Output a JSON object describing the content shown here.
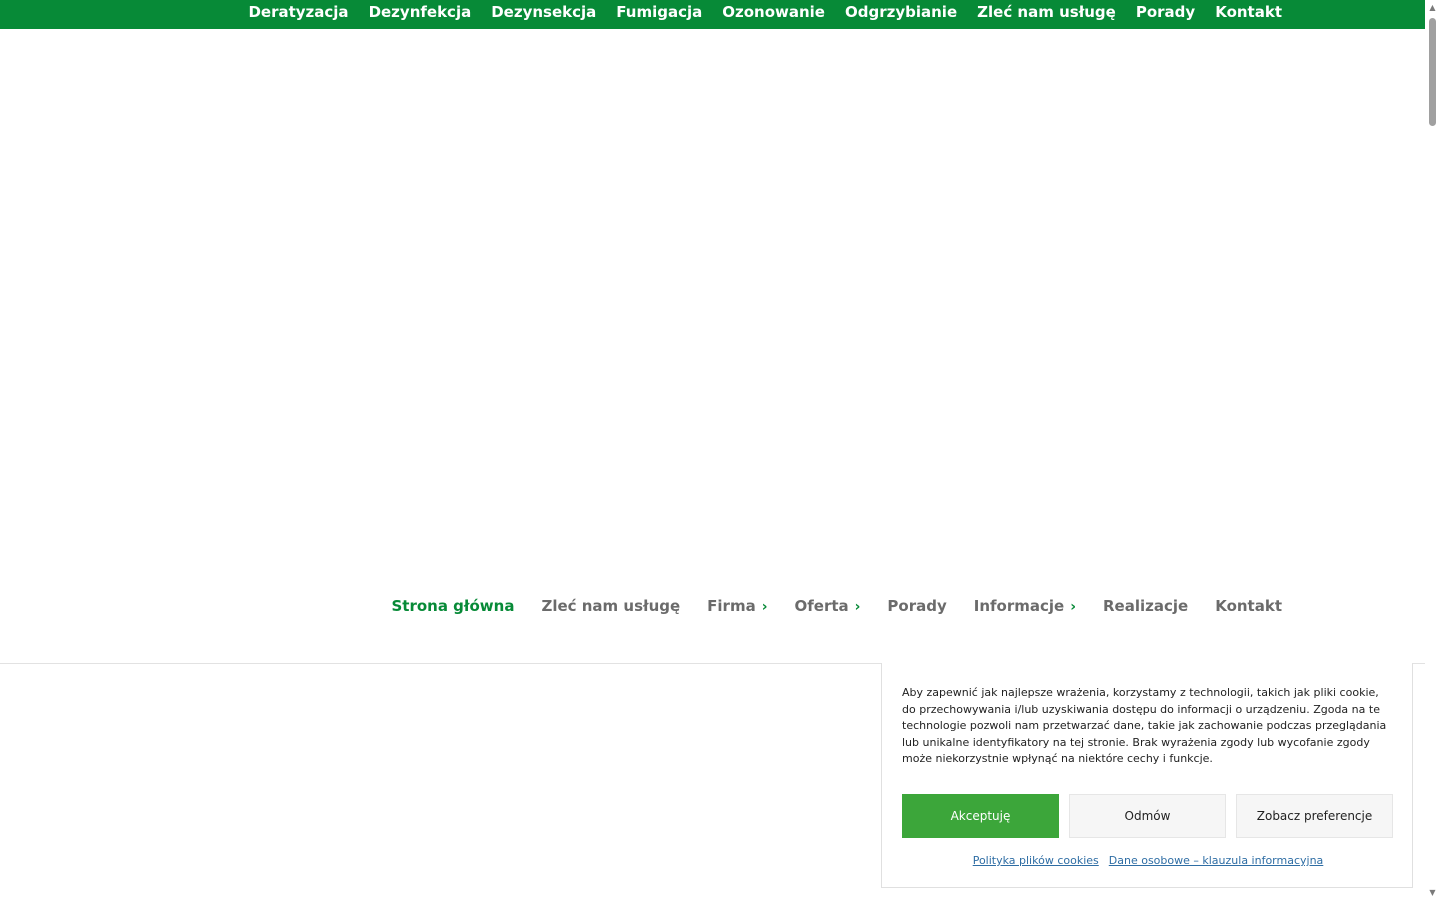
{
  "topbar": {
    "links": [
      "Deratyzacja",
      "Dezynfekcja",
      "Dezynsekcja",
      "Fumigacja",
      "Ozonowanie",
      "Odgrzybianie",
      "Zleć nam usługę",
      "Porady",
      "Kontakt"
    ]
  },
  "mainnav": {
    "items": [
      {
        "label": "Strona główna",
        "active": true,
        "has_submenu": false
      },
      {
        "label": "Zleć nam usługę",
        "active": false,
        "has_submenu": false
      },
      {
        "label": "Firma",
        "active": false,
        "has_submenu": true
      },
      {
        "label": "Oferta",
        "active": false,
        "has_submenu": true
      },
      {
        "label": "Porady",
        "active": false,
        "has_submenu": false
      },
      {
        "label": "Informacje",
        "active": false,
        "has_submenu": true
      },
      {
        "label": "Realizacje",
        "active": false,
        "has_submenu": false
      },
      {
        "label": "Kontakt",
        "active": false,
        "has_submenu": false
      }
    ],
    "submenu_icon": "chevron-right-icon"
  },
  "cookie_banner": {
    "text": "Aby zapewnić jak najlepsze wrażenia, korzystamy z technologii, takich jak pliki cookie, do przechowywania i/lub uzyskiwania dostępu do informacji o urządzeniu. Zgoda na te technologie pozwoli nam przetwarzać dane, takie jak zachowanie podczas przeglądania lub unikalne identyfikatory na tej stronie. Brak wyrażenia zgody lub wycofanie zgody może niekorzystnie wpłynąć na niektóre cechy i funkcje.",
    "accept_label": "Akceptuję",
    "deny_label": "Odmów",
    "prefs_label": "Zobacz preferencje",
    "links": [
      "Polityka plików cookies",
      "Dane osobowe – klauzula informacyjna"
    ]
  },
  "colors": {
    "brand_green": "#078a37",
    "accept_green": "#3ca63a",
    "link_blue": "#2e6da4",
    "nav_gray": "#6b6b6b"
  }
}
